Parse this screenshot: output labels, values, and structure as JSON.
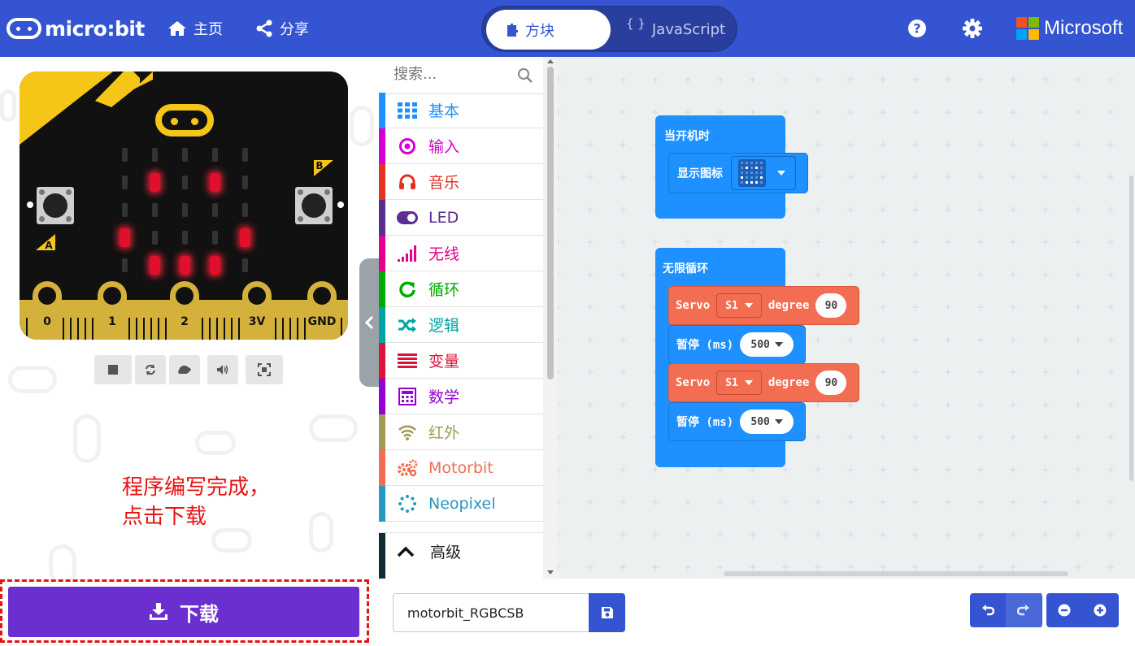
{
  "header": {
    "brand": "micro:bit",
    "home_label": "主页",
    "share_label": "分享",
    "tab_blocks": "方块",
    "tab_js_brace": "{ }",
    "tab_js": "JavaScript",
    "ms_label": "Microsoft",
    "accent_color": "#3454d1"
  },
  "simulator": {
    "button_a": "A",
    "button_b": "B",
    "pins": [
      "0",
      "1",
      "2",
      "3V",
      "GND"
    ],
    "led_grid": [
      [
        0,
        0,
        0,
        0,
        0
      ],
      [
        0,
        1,
        0,
        1,
        0
      ],
      [
        0,
        0,
        0,
        0,
        0
      ],
      [
        1,
        0,
        0,
        0,
        1
      ],
      [
        0,
        1,
        1,
        1,
        0
      ]
    ],
    "toolbar_icons": [
      "stop-icon",
      "restart-icon",
      "slowmo-icon",
      "mute-icon",
      "fullscreen-icon"
    ]
  },
  "annotation": {
    "line1": "程序编写完成，",
    "line2": "点击下载"
  },
  "download": {
    "label": "下载"
  },
  "toolbox": {
    "search_placeholder": "搜索...",
    "categories": [
      {
        "label": "基本",
        "color": "#1e90ff",
        "icon": "grid-icon"
      },
      {
        "label": "输入",
        "color": "#d400d4",
        "icon": "input-icon"
      },
      {
        "label": "音乐",
        "color": "#e63022",
        "icon": "headphones-icon"
      },
      {
        "label": "LED",
        "color": "#5c2d91",
        "icon": "toggle-icon"
      },
      {
        "label": "无线",
        "color": "#e3008c",
        "icon": "signal-icon"
      },
      {
        "label": "循环",
        "color": "#00aa00",
        "icon": "loop-icon"
      },
      {
        "label": "逻辑",
        "color": "#00a4a6",
        "icon": "shuffle-icon"
      },
      {
        "label": "变量",
        "color": "#dc143c",
        "icon": "lines-icon"
      },
      {
        "label": "数学",
        "color": "#9400d3",
        "icon": "calculator-icon"
      },
      {
        "label": "红外",
        "color": "#a19a53",
        "icon": "wifi-icon"
      },
      {
        "label": "Motorbit",
        "color": "#f26d52",
        "icon": "gears-icon"
      },
      {
        "label": "Neopixel",
        "color": "#2699bf",
        "icon": "dots-circle-icon"
      }
    ],
    "advanced_label": "高级"
  },
  "workspace": {
    "on_start_label": "当开机时",
    "show_icon_label": "显示图标",
    "forever_label": "无限循环",
    "servo_block_1": {
      "servo": "Servo",
      "channel": "S1",
      "degree_label": "degree",
      "degree": "90"
    },
    "pause_block_1": {
      "label": "暂停 (ms)",
      "value": "500"
    },
    "servo_block_2": {
      "servo": "Servo",
      "channel": "S1",
      "degree_label": "degree",
      "degree": "90"
    },
    "pause_block_2": {
      "label": "暂停 (ms)",
      "value": "500"
    },
    "colors": {
      "basic": "#1e90ff",
      "motorbit": "#f26d52"
    }
  },
  "bottom": {
    "project_name": "motorbit_RGBCSB"
  }
}
